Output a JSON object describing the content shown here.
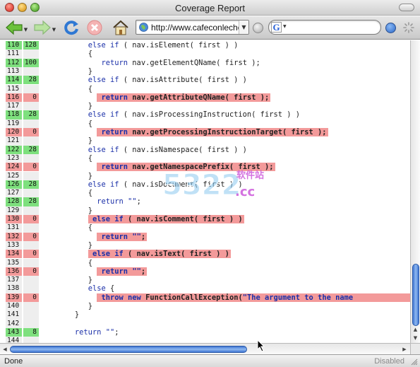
{
  "window": {
    "title": "Coverage Report"
  },
  "toolbar": {
    "url": "http://www.cafeconleche"
  },
  "code_rows": [
    {
      "line": "110",
      "count": "128",
      "status": "hit",
      "code": "else if ( nav.isElement( first ) )",
      "indent": 10,
      "red_from": -1
    },
    {
      "line": "111",
      "count": "",
      "status": "plain",
      "code": "{",
      "indent": 10,
      "red_from": -1
    },
    {
      "line": "112",
      "count": "100",
      "status": "hit",
      "code": "return nav.getElementQName( first );",
      "indent": 13,
      "red_from": -1
    },
    {
      "line": "113",
      "count": "",
      "status": "plain",
      "code": "}",
      "indent": 10,
      "red_from": -1
    },
    {
      "line": "114",
      "count": "28",
      "status": "hit",
      "code": "else if ( nav.isAttribute( first ) )",
      "indent": 10,
      "red_from": -1
    },
    {
      "line": "115",
      "count": "",
      "status": "plain",
      "code": "{",
      "indent": 10,
      "red_from": -1
    },
    {
      "line": "116",
      "count": "0",
      "status": "miss",
      "code": "return nav.getAttributeQName( first );",
      "indent": 13,
      "red_from": 0
    },
    {
      "line": "117",
      "count": "",
      "status": "plain",
      "code": "}",
      "indent": 10,
      "red_from": -1
    },
    {
      "line": "118",
      "count": "28",
      "status": "hit",
      "code": "else if ( nav.isProcessingInstruction( first ) )",
      "indent": 10,
      "red_from": -1
    },
    {
      "line": "119",
      "count": "",
      "status": "plain",
      "code": "{",
      "indent": 10,
      "red_from": -1
    },
    {
      "line": "120",
      "count": "0",
      "status": "miss",
      "code": "return nav.getProcessingInstructionTarget( first );",
      "indent": 13,
      "red_from": 0
    },
    {
      "line": "121",
      "count": "",
      "status": "plain",
      "code": "}",
      "indent": 10,
      "red_from": -1
    },
    {
      "line": "122",
      "count": "28",
      "status": "hit",
      "code": "else if ( nav.isNamespace( first ) )",
      "indent": 10,
      "red_from": -1
    },
    {
      "line": "123",
      "count": "",
      "status": "plain",
      "code": "{",
      "indent": 10,
      "red_from": -1
    },
    {
      "line": "124",
      "count": "0",
      "status": "miss",
      "code": "return nav.getNamespacePrefix( first );",
      "indent": 13,
      "red_from": 0
    },
    {
      "line": "125",
      "count": "",
      "status": "plain",
      "code": "}",
      "indent": 10,
      "red_from": -1
    },
    {
      "line": "126",
      "count": "28",
      "status": "hit",
      "code": "else if ( nav.isDocument( first ) )",
      "indent": 10,
      "red_from": -1
    },
    {
      "line": "127",
      "count": "",
      "status": "plain",
      "code": "{",
      "indent": 10,
      "red_from": -1
    },
    {
      "line": "128",
      "count": "28",
      "status": "hit",
      "code": "return \"\";",
      "indent": 12,
      "red_from": -1
    },
    {
      "line": "129",
      "count": "",
      "status": "plain",
      "code": "}",
      "indent": 10,
      "red_from": -1
    },
    {
      "line": "130",
      "count": "0",
      "status": "miss",
      "code": "else if ( nav.isComment( first ) )",
      "indent": 11,
      "red_from": 0
    },
    {
      "line": "131",
      "count": "",
      "status": "plain",
      "code": "{",
      "indent": 10,
      "red_from": -1
    },
    {
      "line": "132",
      "count": "0",
      "status": "miss",
      "code": "return \"\";",
      "indent": 13,
      "red_from": 0
    },
    {
      "line": "133",
      "count": "",
      "status": "plain",
      "code": "}",
      "indent": 10,
      "red_from": -1
    },
    {
      "line": "134",
      "count": "0",
      "status": "miss",
      "code": "else if ( nav.isText( first ) )",
      "indent": 11,
      "red_from": 0
    },
    {
      "line": "135",
      "count": "",
      "status": "plain",
      "code": "{",
      "indent": 10,
      "red_from": -1
    },
    {
      "line": "136",
      "count": "0",
      "status": "miss",
      "code": "return \"\";",
      "indent": 13,
      "red_from": 0
    },
    {
      "line": "137",
      "count": "",
      "status": "plain",
      "code": "}",
      "indent": 10,
      "red_from": -1
    },
    {
      "line": "138",
      "count": "",
      "status": "plain",
      "code": "else {",
      "indent": 10,
      "red_from": -1
    },
    {
      "line": "139",
      "count": "0",
      "status": "miss",
      "code": "throw new FunctionCallException(\"The argument to the name",
      "indent": 13,
      "red_from": 0
    },
    {
      "line": "140",
      "count": "",
      "status": "plain",
      "code": "}",
      "indent": 10,
      "red_from": -1
    },
    {
      "line": "141",
      "count": "",
      "status": "plain",
      "code": "}",
      "indent": 7,
      "red_from": -1
    },
    {
      "line": "142",
      "count": "",
      "status": "plain",
      "code": "",
      "indent": 0,
      "red_from": -1
    },
    {
      "line": "143",
      "count": "8",
      "status": "hit",
      "code": "return \"\";",
      "indent": 7,
      "red_from": -1
    },
    {
      "line": "144",
      "count": "",
      "status": "plain",
      "code": "",
      "indent": 0,
      "red_from": -1
    }
  ],
  "watermark": {
    "digits": "5322",
    "chinese": "软件站",
    "suffix": ".cc"
  },
  "status": {
    "text": "Done",
    "right": "Disabled"
  },
  "colors": {
    "hit": "#7ee07e",
    "miss": "#f39a9a",
    "plain": "#eeeeee",
    "keyword": "#1a2fa8"
  }
}
